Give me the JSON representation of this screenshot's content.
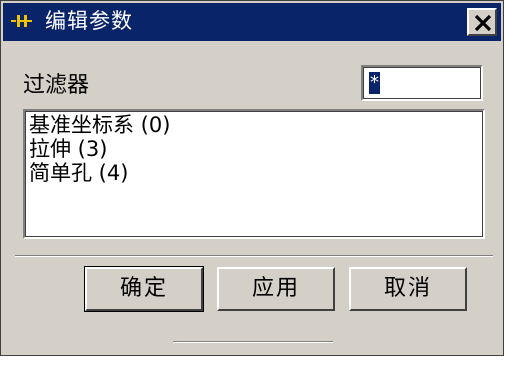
{
  "window": {
    "title": "编辑参数",
    "icons": {
      "title": "window-app-icon",
      "close": "close-x-icon"
    }
  },
  "filter": {
    "label": "过滤器",
    "value": "*"
  },
  "features": {
    "items": [
      "基准坐标系 (0)",
      "拉伸 (3)",
      "简单孔 (4)"
    ]
  },
  "buttons": {
    "ok": "确定",
    "apply": "应用",
    "cancel": "取消"
  },
  "colors": {
    "titlebar": "#0a246a",
    "dialog": "#d4d0c8",
    "title_icon": "#f2c200"
  }
}
